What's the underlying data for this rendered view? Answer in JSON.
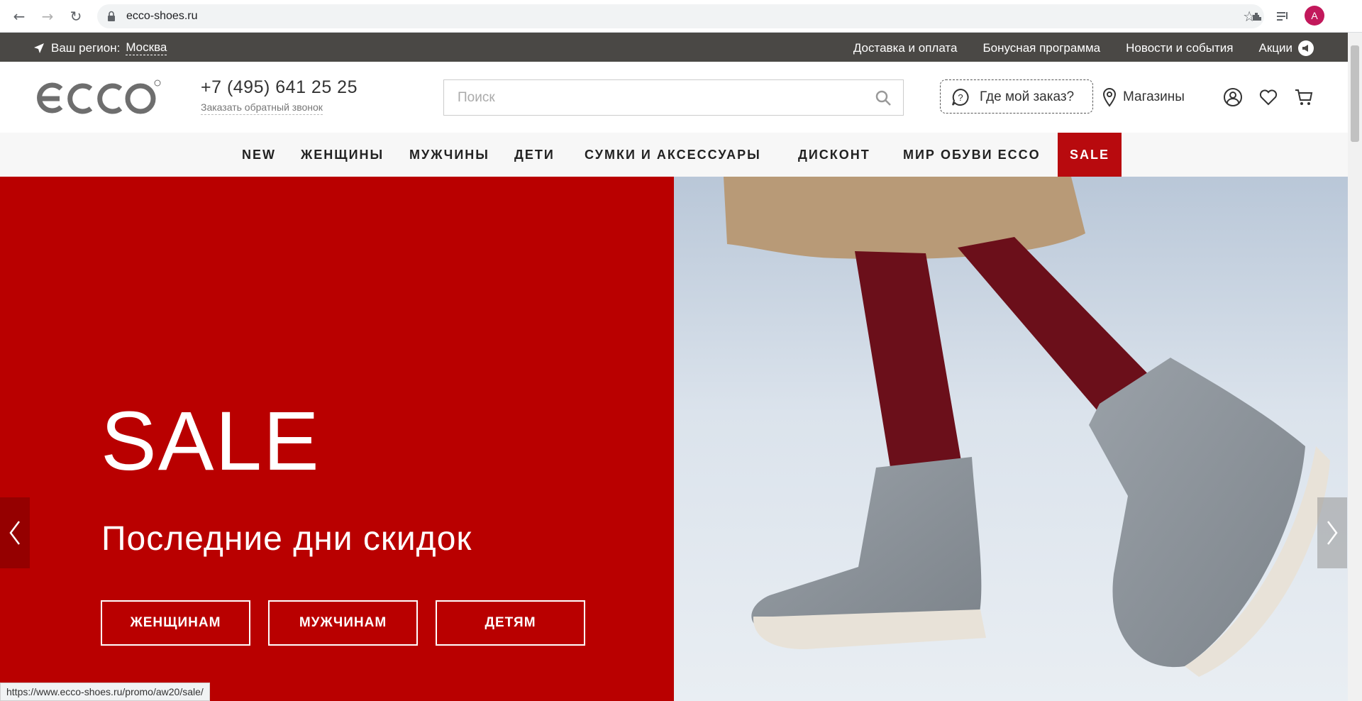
{
  "browser": {
    "url": "ecco-shoes.ru",
    "avatar_letter": "A",
    "status_url": "https://www.ecco-shoes.ru/promo/aw20/sale/"
  },
  "topbar": {
    "region_label": "Ваш регион:",
    "region_city": "Москва",
    "links": [
      "Доставка и оплата",
      "Бонусная программа",
      "Новости и события",
      "Акции"
    ]
  },
  "header": {
    "phone": "+7 (495) 641 25 25",
    "callback": "Заказать обратный звонок",
    "search_placeholder": "Поиск",
    "order_tracking": "Где мой заказ?",
    "stores": "Магазины"
  },
  "nav": {
    "items": [
      "NEW",
      "ЖЕНЩИНЫ",
      "МУЖЧИНЫ",
      "ДЕТИ",
      "СУМКИ И АКСЕССУАРЫ",
      "ДИСКОНТ",
      "МИР ОБУВИ ECCO",
      "SALE"
    ]
  },
  "hero": {
    "title": "SALE",
    "subtitle": "Последние дни скидок",
    "buttons": [
      "ЖЕНЩИНАМ",
      "МУЖЧИНАМ",
      "ДЕТЯМ"
    ]
  },
  "colors": {
    "brand_red": "#b90000",
    "topbar": "#4a4845"
  }
}
